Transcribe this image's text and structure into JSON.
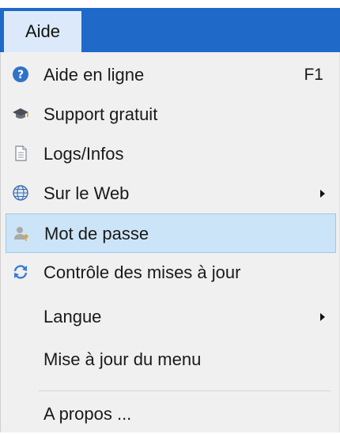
{
  "menubar": {
    "title": "Aide"
  },
  "menu": {
    "items": [
      {
        "label": "Aide en ligne",
        "shortcut": "F1",
        "icon": "help-icon"
      },
      {
        "label": "Support gratuit",
        "icon": "graduation-cap-icon"
      },
      {
        "label": "Logs/Infos",
        "icon": "document-icon"
      },
      {
        "label": "Sur le Web",
        "icon": "globe-icon",
        "submenu": true
      },
      {
        "label": "Mot de passe",
        "icon": "user-key-icon",
        "highlighted": true
      },
      {
        "label": "Contrôle des mises à jour",
        "icon": "refresh-icon"
      },
      {
        "label": "Langue",
        "submenu": true
      },
      {
        "label": "Mise à jour du menu"
      },
      {
        "label": "A propos ..."
      }
    ]
  },
  "colors": {
    "menubar_accent": "#1f69c8",
    "menu_title_bg": "#dbe9fa",
    "highlight_bg": "#cce4f7",
    "highlight_border": "#99c9ef",
    "menu_bg": "#f0f0f0"
  }
}
